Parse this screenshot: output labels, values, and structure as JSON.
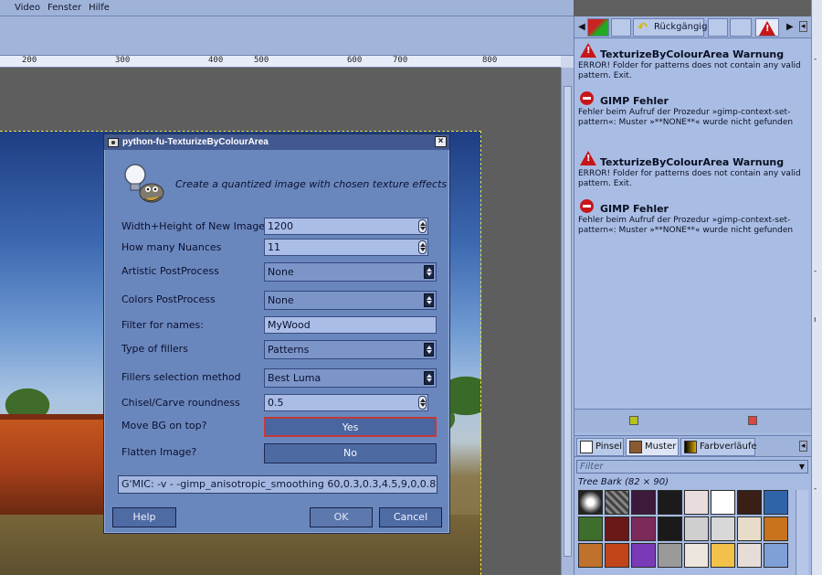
{
  "menubar": {
    "items": [
      "",
      "Video",
      "Fenster",
      "Hilfe"
    ]
  },
  "ruler": {
    "labels": [
      "200",
      "300",
      "400",
      "500",
      "600",
      "700",
      "800"
    ]
  },
  "dialog": {
    "title": "python-fu-TexturizeByColourArea",
    "description": "Create a quantized image with chosen texture effects",
    "fields": {
      "width_height": {
        "label": "Width+Height of New Image",
        "value": "1200"
      },
      "nuances": {
        "label": "How many Nuances",
        "value": "11"
      },
      "artistic": {
        "label": "Artistic PostProcess",
        "value": "None"
      },
      "colors": {
        "label": "Colors PostProcess",
        "value": "None"
      },
      "filter": {
        "label": "Filter for names:",
        "value": "MyWood"
      },
      "fillers_type": {
        "label": "Type of fillers",
        "value": "Patterns"
      },
      "fillers_method": {
        "label": "Fillers selection method",
        "value": "Best Luma"
      },
      "chisel": {
        "label": "Chisel/Carve roundness",
        "value": "0.5"
      },
      "move_bg": {
        "label": "Move BG on top?",
        "value": "Yes"
      },
      "flatten": {
        "label": "Flatten Image?",
        "value": "No"
      }
    },
    "gmic": "G'MIC: -v - -gimp_anisotropic_smoothing 60,0.3,0.3,4.5,9,0,0.8,...",
    "buttons": {
      "help": "Help",
      "ok": "OK",
      "cancel": "Cancel"
    }
  },
  "dock": {
    "undo_label": "Rückgängig",
    "messages": [
      {
        "type": "warning",
        "title": "TexturizeByColourArea Warnung",
        "text": "ERROR! Folder for patterns does not contain any valid pattern. Exit."
      },
      {
        "type": "error",
        "title": "GIMP Fehler",
        "text": "Fehler beim Aufruf der Prozedur »gimp-context-set-pattern«: Muster »**NONE**« wurde nicht gefunden"
      },
      {
        "type": "warning",
        "title": "TexturizeByColourArea Warnung",
        "text": "ERROR! Folder for patterns does not contain any valid pattern. Exit."
      },
      {
        "type": "error",
        "title": "GIMP Fehler",
        "text": "Fehler beim Aufruf der Prozedur »gimp-context-set-pattern«: Muster »**NONE**« wurde nicht gefunden"
      }
    ],
    "pattern_tabs": [
      "Pinsel",
      "Muster",
      "Farbverläufe"
    ],
    "filter_placeholder": "Filter",
    "pattern_name": "Tree Bark (82 × 90)"
  },
  "colors": {
    "accent_red": "#c23a3a",
    "dialog_bg": "#6a87bd",
    "dock_bg": "#a9bde4"
  }
}
